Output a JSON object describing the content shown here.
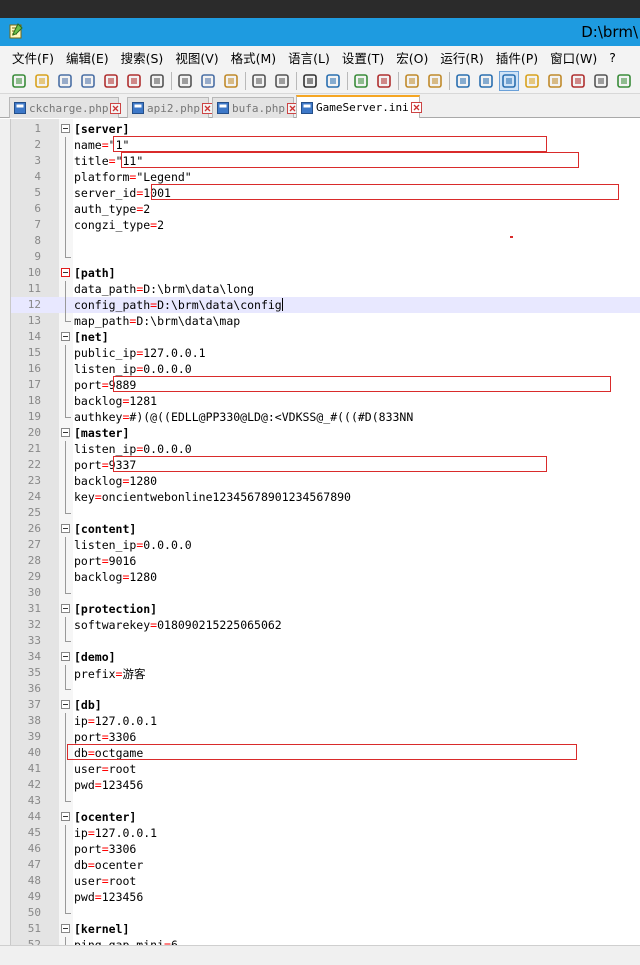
{
  "window": {
    "title": "D:\\brm\\",
    "app_icon": "notepad-plus-icon",
    "accent": "#1e9be0"
  },
  "menu": [
    {
      "label": "文件(F)"
    },
    {
      "label": "编辑(E)"
    },
    {
      "label": "搜索(S)"
    },
    {
      "label": "视图(V)"
    },
    {
      "label": "格式(M)"
    },
    {
      "label": "语言(L)"
    },
    {
      "label": "设置(T)"
    },
    {
      "label": "宏(O)"
    },
    {
      "label": "运行(R)"
    },
    {
      "label": "插件(P)"
    },
    {
      "label": "窗口(W)"
    },
    {
      "label": "?"
    }
  ],
  "toolbar": {
    "icons": [
      "new-file-icon",
      "open-file-icon",
      "save-icon",
      "save-all-icon",
      "close-icon",
      "close-all-icon",
      "print-icon",
      "cut-icon",
      "copy-icon",
      "paste-icon",
      "undo-icon",
      "redo-icon",
      "find-icon",
      "replace-icon",
      "zoom-in-icon",
      "zoom-out-icon",
      "sync-vertical-icon",
      "sync-horizontal-icon",
      "word-wrap-icon",
      "show-all-chars-icon",
      "indent-guide-icon",
      "document-map-icon",
      "function-list-icon",
      "record-macro-icon",
      "stop-macro-icon",
      "play-macro-icon"
    ]
  },
  "tabs": [
    {
      "label": "ckcharge.php",
      "active": false
    },
    {
      "label": "api2.php",
      "active": false
    },
    {
      "label": "bufa.php",
      "active": false
    },
    {
      "label": "GameServer.ini",
      "active": true
    }
  ],
  "lines": [
    {
      "n": "1",
      "t": "section",
      "text": "[server]"
    },
    {
      "n": "2",
      "t": "kv",
      "k": "name",
      "v": "\"1\""
    },
    {
      "n": "3",
      "t": "kv",
      "k": "title",
      "v": "\"11\""
    },
    {
      "n": "4",
      "t": "kv",
      "k": "platform",
      "v": "\"Legend\""
    },
    {
      "n": "5",
      "t": "kv",
      "k": "server_id",
      "v": "1001"
    },
    {
      "n": "6",
      "t": "kv",
      "k": "auth_type",
      "v": "2"
    },
    {
      "n": "7",
      "t": "kv",
      "k": "congzi_type",
      "v": "2"
    },
    {
      "n": "8",
      "t": "blank"
    },
    {
      "n": "9",
      "t": "blank"
    },
    {
      "n": "10",
      "t": "section",
      "text": "[path]"
    },
    {
      "n": "11",
      "t": "kv",
      "k": "data_path",
      "v": "D:\\brm\\data\\long"
    },
    {
      "n": "12",
      "t": "kv",
      "k": "config_path",
      "v": "D:\\brm\\data\\config"
    },
    {
      "n": "13",
      "t": "kv",
      "k": "map_path",
      "v": "D:\\brm\\data\\map"
    },
    {
      "n": "14",
      "t": "section",
      "text": "[net]"
    },
    {
      "n": "15",
      "t": "kv",
      "k": "public_ip",
      "v": "127.0.0.1"
    },
    {
      "n": "16",
      "t": "kv",
      "k": "listen_ip",
      "v": "0.0.0.0"
    },
    {
      "n": "17",
      "t": "kv",
      "k": "port",
      "v": "9889"
    },
    {
      "n": "18",
      "t": "kv",
      "k": "backlog",
      "v": "1281"
    },
    {
      "n": "19",
      "t": "kv",
      "k": "authkey",
      "v": "#)(@((EDLL@PP330@LD@:<VDKSS@_#(((#D(833NN"
    },
    {
      "n": "20",
      "t": "section",
      "text": "[master]"
    },
    {
      "n": "21",
      "t": "kv",
      "k": "listen_ip",
      "v": "0.0.0.0"
    },
    {
      "n": "22",
      "t": "kv",
      "k": "port",
      "v": "9337"
    },
    {
      "n": "23",
      "t": "kv",
      "k": "backlog",
      "v": "1280"
    },
    {
      "n": "24",
      "t": "kv",
      "k": "key",
      "v": "oncientwebonline12345678901234567890"
    },
    {
      "n": "25",
      "t": "blank"
    },
    {
      "n": "26",
      "t": "section",
      "text": "[content]"
    },
    {
      "n": "27",
      "t": "kv",
      "k": "listen_ip",
      "v": "0.0.0.0"
    },
    {
      "n": "28",
      "t": "kv",
      "k": "port",
      "v": "9016"
    },
    {
      "n": "29",
      "t": "kv",
      "k": "backlog",
      "v": "1280"
    },
    {
      "n": "30",
      "t": "blank"
    },
    {
      "n": "31",
      "t": "section",
      "text": "[protection]"
    },
    {
      "n": "32",
      "t": "kv",
      "k": "softwarekey",
      "v": "018090215225065062"
    },
    {
      "n": "33",
      "t": "blank"
    },
    {
      "n": "34",
      "t": "section",
      "text": "[demo]"
    },
    {
      "n": "35",
      "t": "kv",
      "k": "prefix",
      "v": "游客"
    },
    {
      "n": "36",
      "t": "blank"
    },
    {
      "n": "37",
      "t": "section",
      "text": "[db]"
    },
    {
      "n": "38",
      "t": "kv",
      "k": "ip",
      "v": "127.0.0.1"
    },
    {
      "n": "39",
      "t": "kv",
      "k": "port",
      "v": "3306"
    },
    {
      "n": "40",
      "t": "kv",
      "k": "db",
      "v": "octgame"
    },
    {
      "n": "41",
      "t": "kv",
      "k": "user",
      "v": "root"
    },
    {
      "n": "42",
      "t": "kv",
      "k": "pwd",
      "v": "123456"
    },
    {
      "n": "43",
      "t": "blank"
    },
    {
      "n": "44",
      "t": "section",
      "text": "[ocenter]"
    },
    {
      "n": "45",
      "t": "kv",
      "k": "ip",
      "v": "127.0.0.1"
    },
    {
      "n": "46",
      "t": "kv",
      "k": "port",
      "v": "3306"
    },
    {
      "n": "47",
      "t": "kv",
      "k": "db",
      "v": "ocenter"
    },
    {
      "n": "48",
      "t": "kv",
      "k": "user",
      "v": "root"
    },
    {
      "n": "49",
      "t": "kv",
      "k": "pwd",
      "v": "123456"
    },
    {
      "n": "50",
      "t": "blank"
    },
    {
      "n": "51",
      "t": "section",
      "text": "[kernel]"
    },
    {
      "n": "52",
      "t": "kv",
      "k": "ping_gap_mini",
      "v": "6"
    }
  ],
  "editor": {
    "current_line": "12",
    "eq_sign": "=",
    "colors": {
      "section": "#8000ff",
      "operator": "#ff0000",
      "annotation": "#d92b2b",
      "current_line": "#e8e8ff"
    }
  }
}
